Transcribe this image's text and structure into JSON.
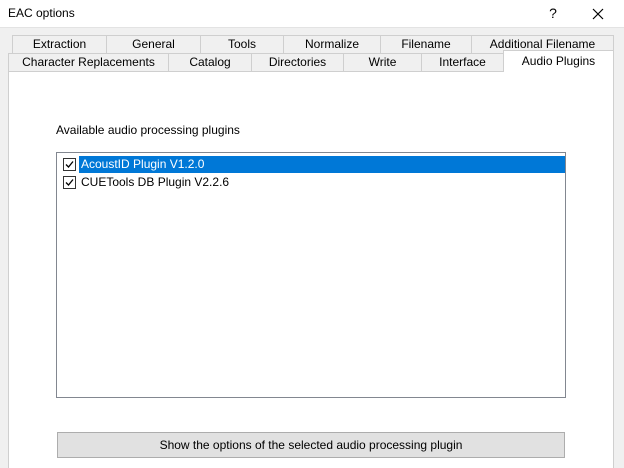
{
  "window": {
    "title": "EAC options",
    "help_label": "?",
    "close_icon": "close-icon"
  },
  "tabs_row1": [
    {
      "label": "Extraction"
    },
    {
      "label": "General"
    },
    {
      "label": "Tools"
    },
    {
      "label": "Normalize"
    },
    {
      "label": "Filename"
    },
    {
      "label": "Additional Filename"
    }
  ],
  "tabs_row2": [
    {
      "label": "Character Replacements"
    },
    {
      "label": "Catalog"
    },
    {
      "label": "Directories"
    },
    {
      "label": "Write"
    },
    {
      "label": "Interface"
    },
    {
      "label": "Audio Plugins",
      "active": true
    }
  ],
  "plugins": {
    "section_label": "Available audio processing plugins",
    "items": [
      {
        "label": "AcoustID Plugin V1.2.0",
        "checked": true,
        "selected": true
      },
      {
        "label": "CUETools DB Plugin V2.2.6",
        "checked": true,
        "selected": false
      }
    ],
    "options_button_label": "Show the options of the selected audio processing plugin"
  },
  "colors": {
    "selection": "#0078d7",
    "dialog_bg": "#f0f0f0",
    "panel_bg": "#ffffff"
  }
}
